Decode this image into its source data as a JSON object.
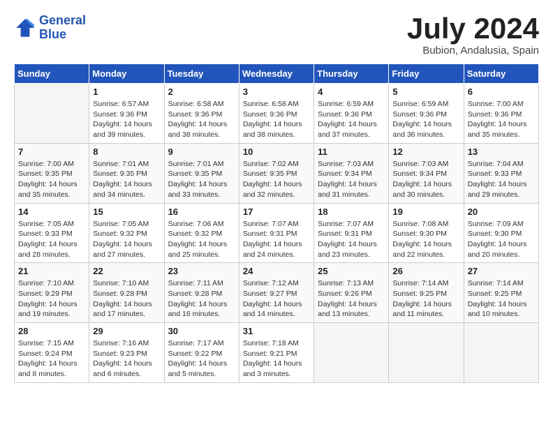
{
  "logo": {
    "line1": "General",
    "line2": "Blue"
  },
  "title": "July 2024",
  "subtitle": "Bubion, Andalusia, Spain",
  "days_header": [
    "Sunday",
    "Monday",
    "Tuesday",
    "Wednesday",
    "Thursday",
    "Friday",
    "Saturday"
  ],
  "weeks": [
    [
      {
        "num": "",
        "info": ""
      },
      {
        "num": "1",
        "info": "Sunrise: 6:57 AM\nSunset: 9:36 PM\nDaylight: 14 hours\nand 39 minutes."
      },
      {
        "num": "2",
        "info": "Sunrise: 6:58 AM\nSunset: 9:36 PM\nDaylight: 14 hours\nand 38 minutes."
      },
      {
        "num": "3",
        "info": "Sunrise: 6:58 AM\nSunset: 9:36 PM\nDaylight: 14 hours\nand 38 minutes."
      },
      {
        "num": "4",
        "info": "Sunrise: 6:59 AM\nSunset: 9:36 PM\nDaylight: 14 hours\nand 37 minutes."
      },
      {
        "num": "5",
        "info": "Sunrise: 6:59 AM\nSunset: 9:36 PM\nDaylight: 14 hours\nand 36 minutes."
      },
      {
        "num": "6",
        "info": "Sunrise: 7:00 AM\nSunset: 9:36 PM\nDaylight: 14 hours\nand 35 minutes."
      }
    ],
    [
      {
        "num": "7",
        "info": "Sunrise: 7:00 AM\nSunset: 9:35 PM\nDaylight: 14 hours\nand 35 minutes."
      },
      {
        "num": "8",
        "info": "Sunrise: 7:01 AM\nSunset: 9:35 PM\nDaylight: 14 hours\nand 34 minutes."
      },
      {
        "num": "9",
        "info": "Sunrise: 7:01 AM\nSunset: 9:35 PM\nDaylight: 14 hours\nand 33 minutes."
      },
      {
        "num": "10",
        "info": "Sunrise: 7:02 AM\nSunset: 9:35 PM\nDaylight: 14 hours\nand 32 minutes."
      },
      {
        "num": "11",
        "info": "Sunrise: 7:03 AM\nSunset: 9:34 PM\nDaylight: 14 hours\nand 31 minutes."
      },
      {
        "num": "12",
        "info": "Sunrise: 7:03 AM\nSunset: 9:34 PM\nDaylight: 14 hours\nand 30 minutes."
      },
      {
        "num": "13",
        "info": "Sunrise: 7:04 AM\nSunset: 9:33 PM\nDaylight: 14 hours\nand 29 minutes."
      }
    ],
    [
      {
        "num": "14",
        "info": "Sunrise: 7:05 AM\nSunset: 9:33 PM\nDaylight: 14 hours\nand 28 minutes."
      },
      {
        "num": "15",
        "info": "Sunrise: 7:05 AM\nSunset: 9:32 PM\nDaylight: 14 hours\nand 27 minutes."
      },
      {
        "num": "16",
        "info": "Sunrise: 7:06 AM\nSunset: 9:32 PM\nDaylight: 14 hours\nand 25 minutes."
      },
      {
        "num": "17",
        "info": "Sunrise: 7:07 AM\nSunset: 9:31 PM\nDaylight: 14 hours\nand 24 minutes."
      },
      {
        "num": "18",
        "info": "Sunrise: 7:07 AM\nSunset: 9:31 PM\nDaylight: 14 hours\nand 23 minutes."
      },
      {
        "num": "19",
        "info": "Sunrise: 7:08 AM\nSunset: 9:30 PM\nDaylight: 14 hours\nand 22 minutes."
      },
      {
        "num": "20",
        "info": "Sunrise: 7:09 AM\nSunset: 9:30 PM\nDaylight: 14 hours\nand 20 minutes."
      }
    ],
    [
      {
        "num": "21",
        "info": "Sunrise: 7:10 AM\nSunset: 9:29 PM\nDaylight: 14 hours\nand 19 minutes."
      },
      {
        "num": "22",
        "info": "Sunrise: 7:10 AM\nSunset: 9:28 PM\nDaylight: 14 hours\nand 17 minutes."
      },
      {
        "num": "23",
        "info": "Sunrise: 7:11 AM\nSunset: 9:28 PM\nDaylight: 14 hours\nand 16 minutes."
      },
      {
        "num": "24",
        "info": "Sunrise: 7:12 AM\nSunset: 9:27 PM\nDaylight: 14 hours\nand 14 minutes."
      },
      {
        "num": "25",
        "info": "Sunrise: 7:13 AM\nSunset: 9:26 PM\nDaylight: 14 hours\nand 13 minutes."
      },
      {
        "num": "26",
        "info": "Sunrise: 7:14 AM\nSunset: 9:25 PM\nDaylight: 14 hours\nand 11 minutes."
      },
      {
        "num": "27",
        "info": "Sunrise: 7:14 AM\nSunset: 9:25 PM\nDaylight: 14 hours\nand 10 minutes."
      }
    ],
    [
      {
        "num": "28",
        "info": "Sunrise: 7:15 AM\nSunset: 9:24 PM\nDaylight: 14 hours\nand 8 minutes."
      },
      {
        "num": "29",
        "info": "Sunrise: 7:16 AM\nSunset: 9:23 PM\nDaylight: 14 hours\nand 6 minutes."
      },
      {
        "num": "30",
        "info": "Sunrise: 7:17 AM\nSunset: 9:22 PM\nDaylight: 14 hours\nand 5 minutes."
      },
      {
        "num": "31",
        "info": "Sunrise: 7:18 AM\nSunset: 9:21 PM\nDaylight: 14 hours\nand 3 minutes."
      },
      {
        "num": "",
        "info": ""
      },
      {
        "num": "",
        "info": ""
      },
      {
        "num": "",
        "info": ""
      }
    ]
  ]
}
